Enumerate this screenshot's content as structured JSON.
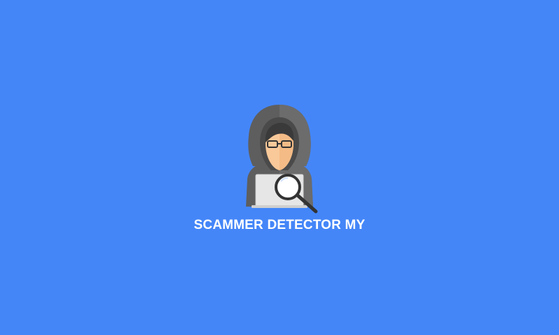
{
  "splash": {
    "app_name": "SCAMMER DETECTOR MY",
    "logo_icon": "hooded-hacker-with-magnifier-icon",
    "background_color": "#4486f8",
    "text_color": "#ffffff"
  }
}
